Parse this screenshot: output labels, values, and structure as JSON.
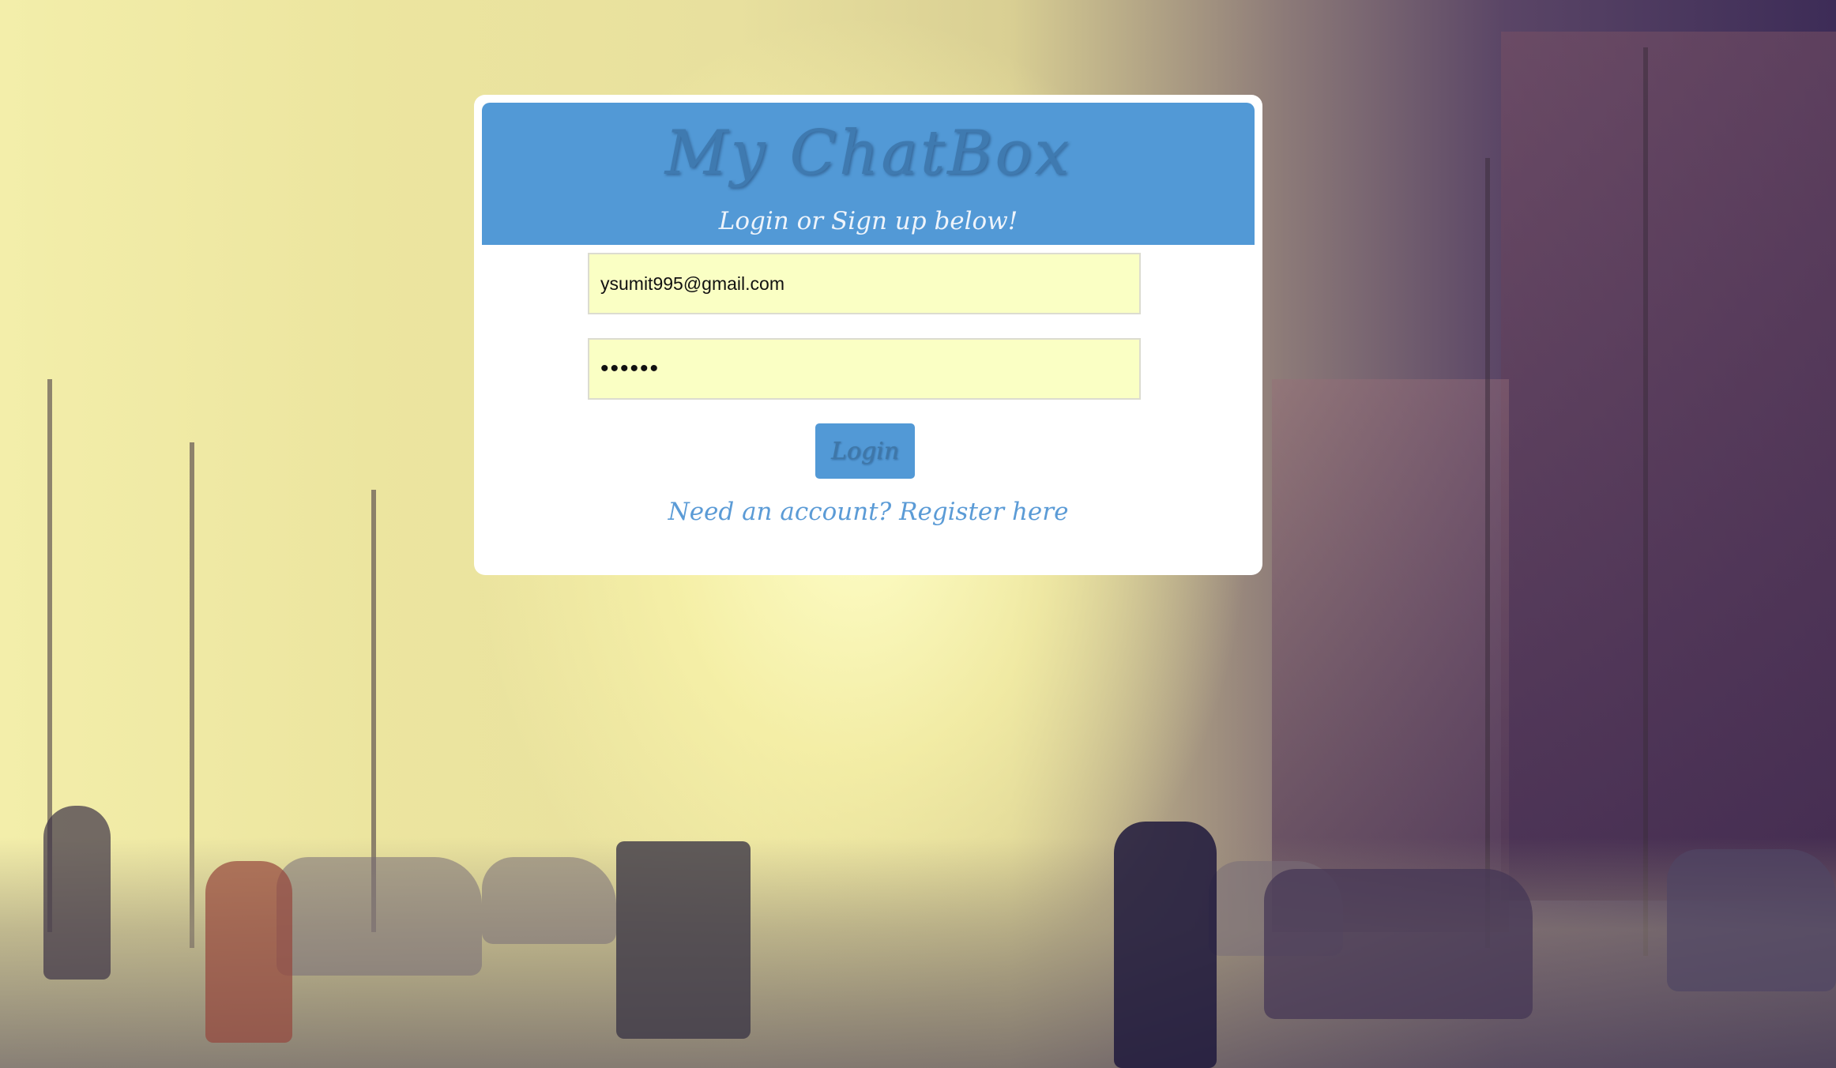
{
  "header": {
    "title": "My ChatBox",
    "subtitle": "Login or Sign up below!"
  },
  "form": {
    "email_value": "ysumit995@gmail.com",
    "password_value": "••••••",
    "login_label": "Login",
    "register_link_text": "Need an account? Register here"
  },
  "colors": {
    "header_bg": "#5299d6",
    "input_bg": "#faffc4",
    "link": "#5b9bd6"
  },
  "background": {
    "description_icon": "street-scene-photo"
  }
}
